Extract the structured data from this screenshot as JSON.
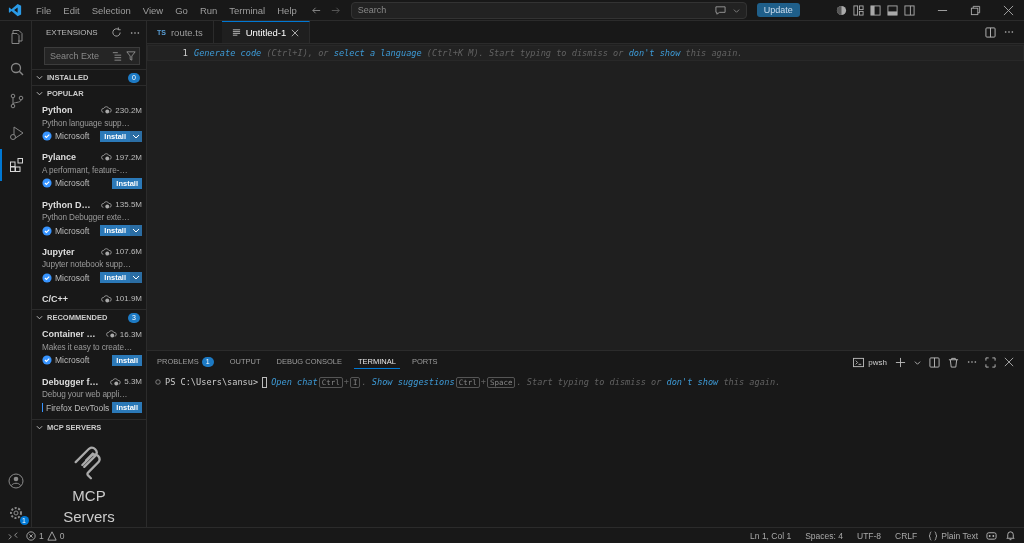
{
  "title_bar": {
    "menu": [
      "File",
      "Edit",
      "Selection",
      "View",
      "Go",
      "Run",
      "Terminal",
      "Help"
    ],
    "search": {
      "placeholder": "Search"
    },
    "update_button": "Update"
  },
  "activity_bar": {
    "items": [
      {
        "kind": "files",
        "selected": false
      },
      {
        "kind": "search",
        "selected": false
      },
      {
        "kind": "source-control",
        "selected": false
      },
      {
        "kind": "run",
        "selected": false
      },
      {
        "kind": "extensions",
        "selected": true
      }
    ],
    "settings_badge": "1"
  },
  "sidebar": {
    "title": "EXTENSIONS",
    "search": {
      "placeholder": "Search Exte"
    },
    "sections": [
      {
        "title": "INSTALLED",
        "expanded": true,
        "badge": "0"
      },
      {
        "title": "POPULAR",
        "expanded": true,
        "items": [
          {
            "name": "Python",
            "downloads": "230.2M",
            "description": "Python language supp…",
            "publisher": "Microsoft",
            "verified": true,
            "install": "Install",
            "dropdown": true
          },
          {
            "name": "Pylance",
            "downloads": "197.2M",
            "description": "A performant, feature-…",
            "publisher": "Microsoft",
            "verified": true,
            "install": "Install",
            "dropdown": false
          },
          {
            "name": "Python D…",
            "downloads": "135.5M",
            "description": "Python Debugger exte…",
            "publisher": "Microsoft",
            "verified": true,
            "install": "Install",
            "dropdown": true
          },
          {
            "name": "Jupyter",
            "downloads": "107.6M",
            "description": "Jupyter notebook supp…",
            "publisher": "Microsoft",
            "verified": true,
            "install": "Install",
            "dropdown": true
          },
          {
            "name": "C/C++",
            "downloads": "101.9M"
          }
        ]
      },
      {
        "title": "RECOMMENDED",
        "expanded": true,
        "badge": "3",
        "items": [
          {
            "name": "Container …",
            "downloads": "16.3M",
            "description": "Makes it easy to create…",
            "publisher": "Microsoft",
            "verified": true,
            "install": "Install",
            "dropdown": false
          },
          {
            "name": "Debugger f…",
            "downloads": "5.3M",
            "description": "Debug your web appli…",
            "publisher": "Firefox DevTools",
            "verified": false,
            "install": "Install",
            "dropdown": false
          }
        ]
      },
      {
        "title": "MCP SERVERS",
        "expanded": true,
        "empty_title": "MCP Servers"
      }
    ]
  },
  "editor": {
    "tabs": [
      {
        "label": "route.ts",
        "icon": "TS",
        "selected": false
      },
      {
        "label": "Untitled-1",
        "selected": true
      }
    ],
    "line_number": "1",
    "hint": [
      {
        "text": "Generate code",
        "kind": "link"
      },
      {
        "text": " (Ctrl+I), or ",
        "kind": "hint"
      },
      {
        "text": "select a language",
        "kind": "link"
      },
      {
        "text": " (Ctrl+K M). Start typing to dismiss or ",
        "kind": "hint"
      },
      {
        "text": "don't show",
        "kind": "link"
      },
      {
        "text": " this again.",
        "kind": "hint"
      }
    ]
  },
  "panel": {
    "tabs": [
      {
        "label": "PROBLEMS",
        "badge": "1",
        "selected": false
      },
      {
        "label": "OUTPUT",
        "selected": false
      },
      {
        "label": "DEBUG CONSOLE",
        "selected": false
      },
      {
        "label": "TERMINAL",
        "selected": true
      },
      {
        "label": "PORTS",
        "selected": false
      }
    ],
    "shell": "pwsh",
    "prompt": "PS C:\\Users\\sansu>",
    "hint": [
      {
        "text": "Open chat",
        "kind": "link"
      },
      {
        "text": "Ctrl",
        "kind": "key"
      },
      {
        "text": "+",
        "kind": "hint"
      },
      {
        "text": "I",
        "kind": "key"
      },
      {
        "text": ". ",
        "kind": "hint"
      },
      {
        "text": "Show suggestions",
        "kind": "link"
      },
      {
        "text": "Ctrl",
        "kind": "key"
      },
      {
        "text": "+",
        "kind": "hint"
      },
      {
        "text": "Space",
        "kind": "key"
      },
      {
        "text": ". Start typing to dismiss or ",
        "kind": "hint"
      },
      {
        "text": "don't show",
        "kind": "link"
      },
      {
        "text": " this again.",
        "kind": "hint"
      }
    ]
  },
  "status_bar": {
    "errors": "1",
    "warnings": "0",
    "right": [
      "Ln 1, Col 1",
      "Spaces: 4",
      "UTF-8",
      "CRLF"
    ],
    "language": "Plain Text"
  }
}
